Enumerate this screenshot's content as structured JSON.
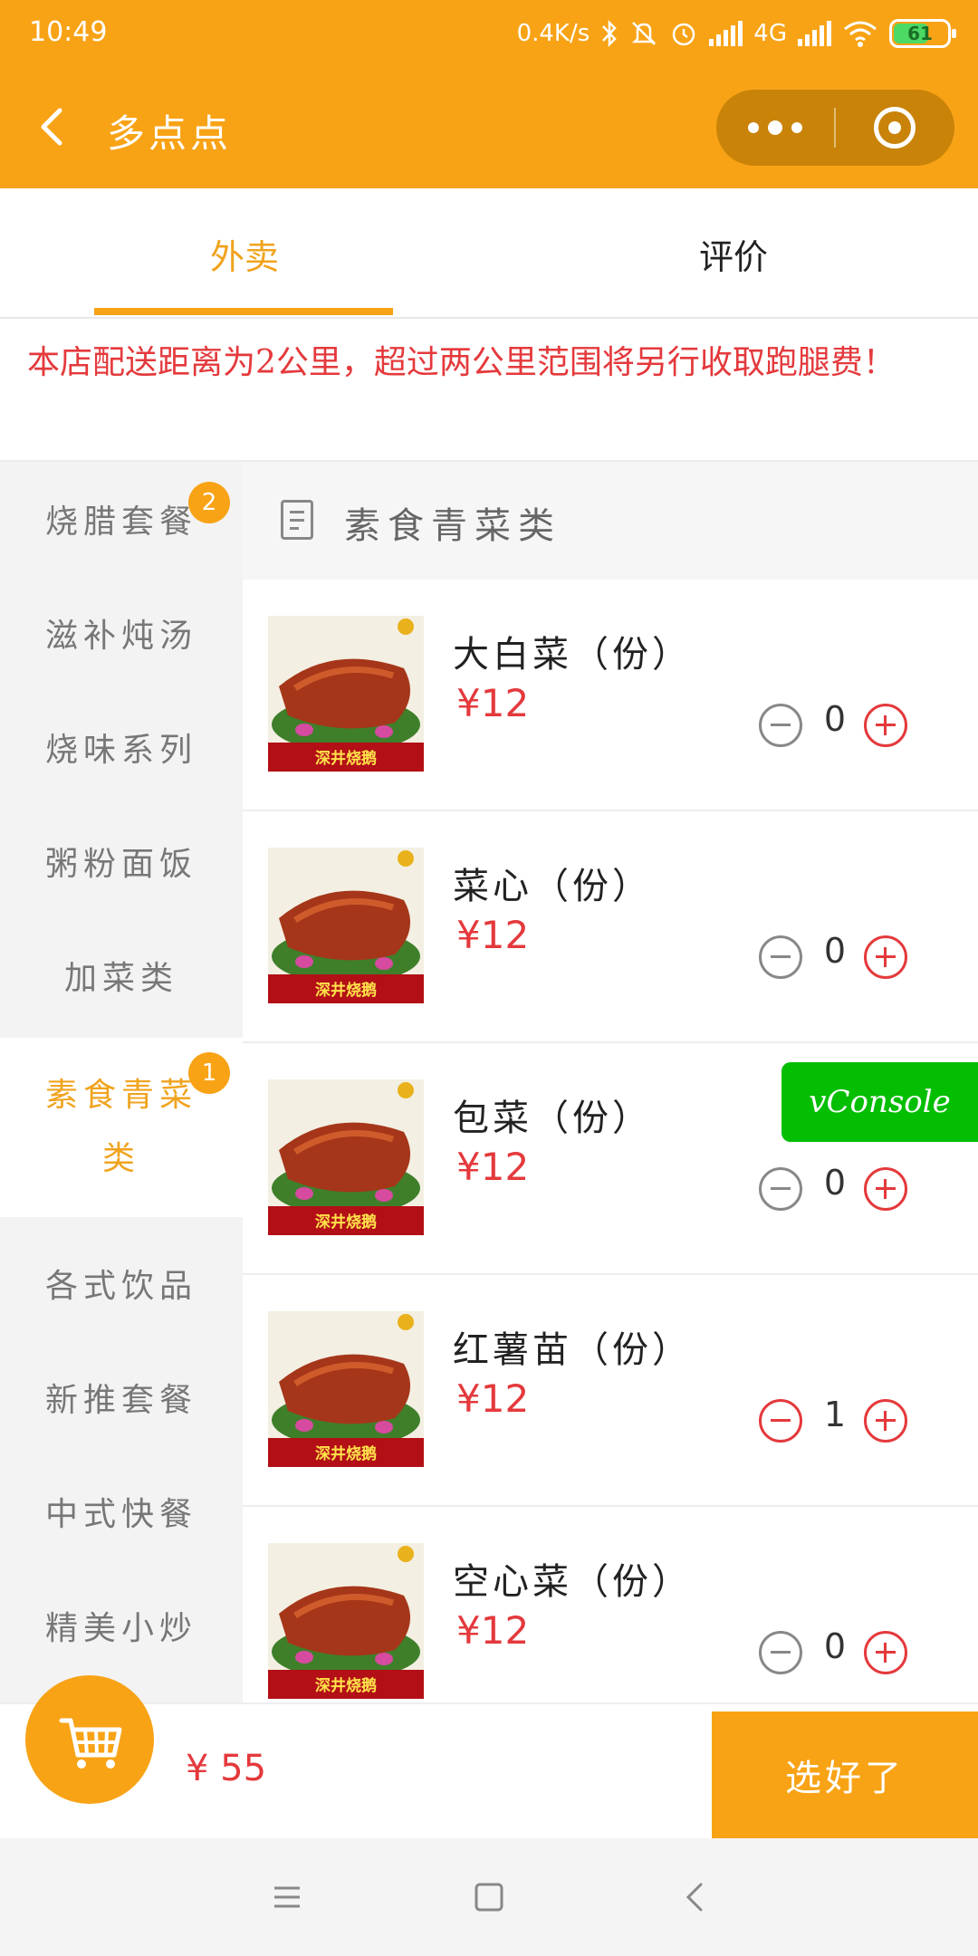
{
  "status_bar": {
    "time": "10:49",
    "net_speed": "0.4K/s",
    "network": "4G",
    "battery": "61"
  },
  "nav": {
    "title": "多点点"
  },
  "tabs": [
    {
      "label": "外卖",
      "active": true
    },
    {
      "label": "评价",
      "active": false
    }
  ],
  "notice": "本店配送距离为2公里，超过两公里范围将另行收取跑腿费！",
  "sidebar": {
    "categories": [
      {
        "label": "烧腊套餐",
        "badge": "2"
      },
      {
        "label": "滋补炖汤"
      },
      {
        "label": "烧味系列"
      },
      {
        "label": "粥粉面饭"
      },
      {
        "label": "加菜类"
      },
      {
        "label": "素食青菜类",
        "badge": "1",
        "active": true
      },
      {
        "label": "各式饮品"
      },
      {
        "label": "新推套餐"
      },
      {
        "label": "中式快餐"
      },
      {
        "label": "精美小炒"
      }
    ]
  },
  "section": {
    "title": "素食青菜类"
  },
  "items": [
    {
      "name": "大白菜（份）",
      "price": "¥12",
      "count": "0",
      "thumb_caption": "深井烧鹅"
    },
    {
      "name": "菜心（份）",
      "price": "¥12",
      "count": "0",
      "thumb_caption": "深井烧鹅"
    },
    {
      "name": "包菜（份）",
      "price": "¥12",
      "count": "0",
      "thumb_caption": "深井烧鹅"
    },
    {
      "name": "红薯苗（份）",
      "price": "¥12",
      "count": "1",
      "thumb_caption": "深井烧鹅"
    },
    {
      "name": "空心菜（份）",
      "price": "¥12",
      "count": "0",
      "thumb_caption": "深井烧鹅"
    }
  ],
  "vconsole_label": "vConsole",
  "cart": {
    "total": "¥ 55",
    "confirm_label": "选好了"
  },
  "colors": {
    "brand": "#f8a316",
    "price": "#e4393c",
    "active_text": "#f0a31e",
    "vconsole": "#04be02"
  },
  "icons": [
    "back-arrow-icon",
    "more-dots-icon",
    "close-target-icon",
    "document-icon",
    "minus-circle-icon",
    "plus-circle-icon",
    "cart-icon",
    "menu-icon",
    "home-square-icon",
    "back-icon"
  ]
}
